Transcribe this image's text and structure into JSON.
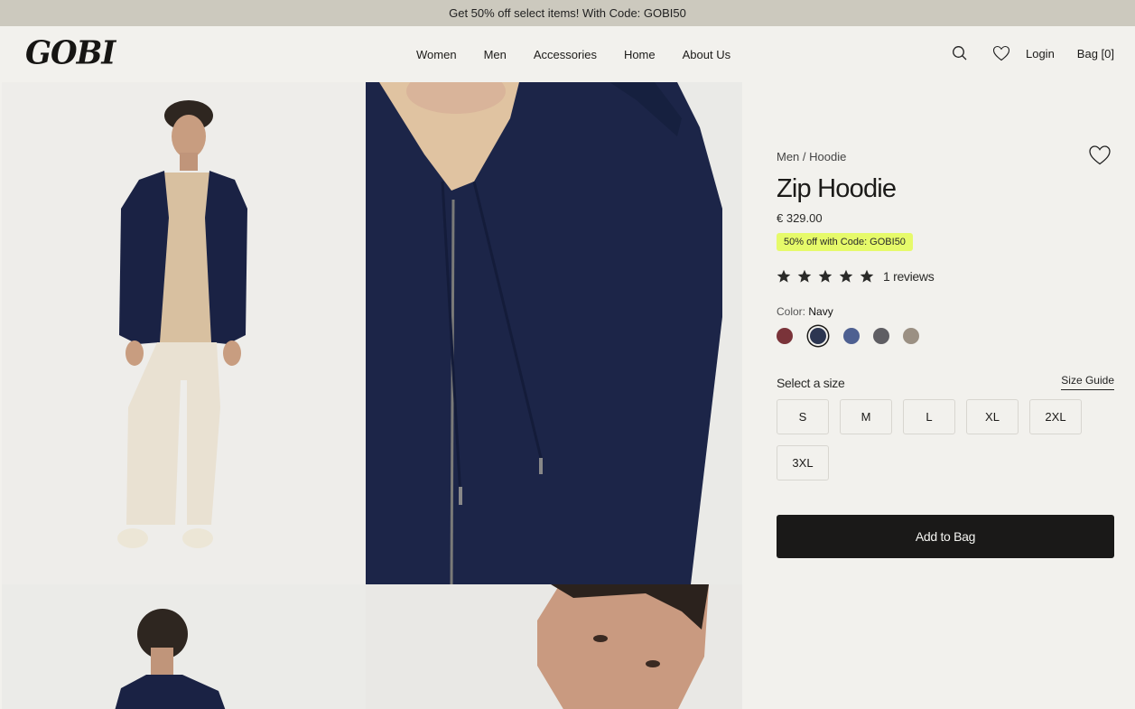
{
  "promo_bar": {
    "text": "Get 50% off select items! With Code: GOBI50"
  },
  "header": {
    "logo": "GOBI",
    "nav": [
      "Women",
      "Men",
      "Accessories",
      "Home",
      "About Us"
    ],
    "search_icon": "search-icon",
    "wishlist_icon": "heart-icon",
    "login": "Login",
    "bag": "Bag [0]"
  },
  "gallery": {
    "images": [
      {
        "alt": "Model wearing navy zip hoodie, full body front view"
      },
      {
        "alt": "Close-up of zip hoodie detail with zipper and drawstrings"
      },
      {
        "alt": "Model wearing hoodie, back view"
      },
      {
        "alt": "Close-up of model's face"
      }
    ]
  },
  "product": {
    "breadcrumb": "Men / Hoodie",
    "title": "Zip Hoodie",
    "price": "€ 329.00",
    "promo_tag": "50% off with Code: GOBI50",
    "rating": {
      "stars": 5,
      "max": 5,
      "reviews_label": "1 reviews"
    },
    "color_label": "Color:",
    "color_selected": "Navy",
    "colors": [
      {
        "name": "Burgundy",
        "hex": "#7a3339",
        "selected": false
      },
      {
        "name": "Navy",
        "hex": "#2c3651",
        "selected": true
      },
      {
        "name": "Blue",
        "hex": "#4e6091",
        "selected": false
      },
      {
        "name": "Charcoal",
        "hex": "#5f5e63",
        "selected": false
      },
      {
        "name": "Taupe",
        "hex": "#9b9083",
        "selected": false
      }
    ],
    "size_label": "Select a size",
    "size_guide": "Size Guide",
    "sizes": [
      "S",
      "M",
      "L",
      "XL",
      "2XL",
      "3XL"
    ],
    "add_to_bag": "Add to Bag"
  },
  "colors": {
    "promo_bar_bg": "#ccc9be",
    "page_bg": "#f2f1ed",
    "promo_tag_bg": "#e6fa6a",
    "button_bg": "#1a1918"
  }
}
